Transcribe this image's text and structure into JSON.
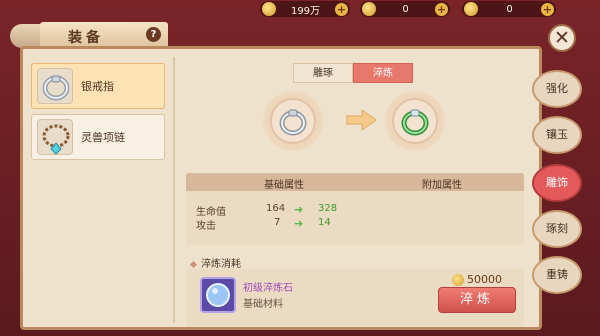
{
  "currencies": [
    {
      "icon": "gold-coin-icon",
      "value": "199万"
    },
    {
      "icon": "gem-icon",
      "value": "0"
    },
    {
      "icon": "token-icon",
      "value": "0"
    }
  ],
  "header": {
    "title": "装备",
    "help": "?"
  },
  "equipment_list": [
    {
      "label": "银戒指",
      "icon": "silver-ring-icon",
      "selected": true
    },
    {
      "label": "灵兽项链",
      "icon": "necklace-icon",
      "selected": false
    }
  ],
  "tabs": [
    {
      "label": "雕琢",
      "active": false
    },
    {
      "label": "淬炼",
      "active": true
    }
  ],
  "attributes": {
    "base_header": "基础属性",
    "extra_header": "附加属性",
    "rows": [
      {
        "name": "生命值",
        "old": "164",
        "new": "328"
      },
      {
        "name": "攻击",
        "old": "7",
        "new": "14"
      }
    ]
  },
  "cost": {
    "title": "淬炼消耗",
    "material_name": "初级淬炼石",
    "material_type": "基础材料",
    "gold": "50000",
    "button": "淬炼"
  },
  "right_tabs": [
    {
      "label": "强化",
      "active": false
    },
    {
      "label": "镶玉",
      "active": false
    },
    {
      "label": "雕饰",
      "active": true
    },
    {
      "label": "琢刻",
      "active": false
    },
    {
      "label": "重铸",
      "active": false
    }
  ],
  "close": "✕",
  "colors": {
    "accent": "#e45a5a",
    "panel": "#efe2cc",
    "upgrade": "#3d9a2c"
  }
}
